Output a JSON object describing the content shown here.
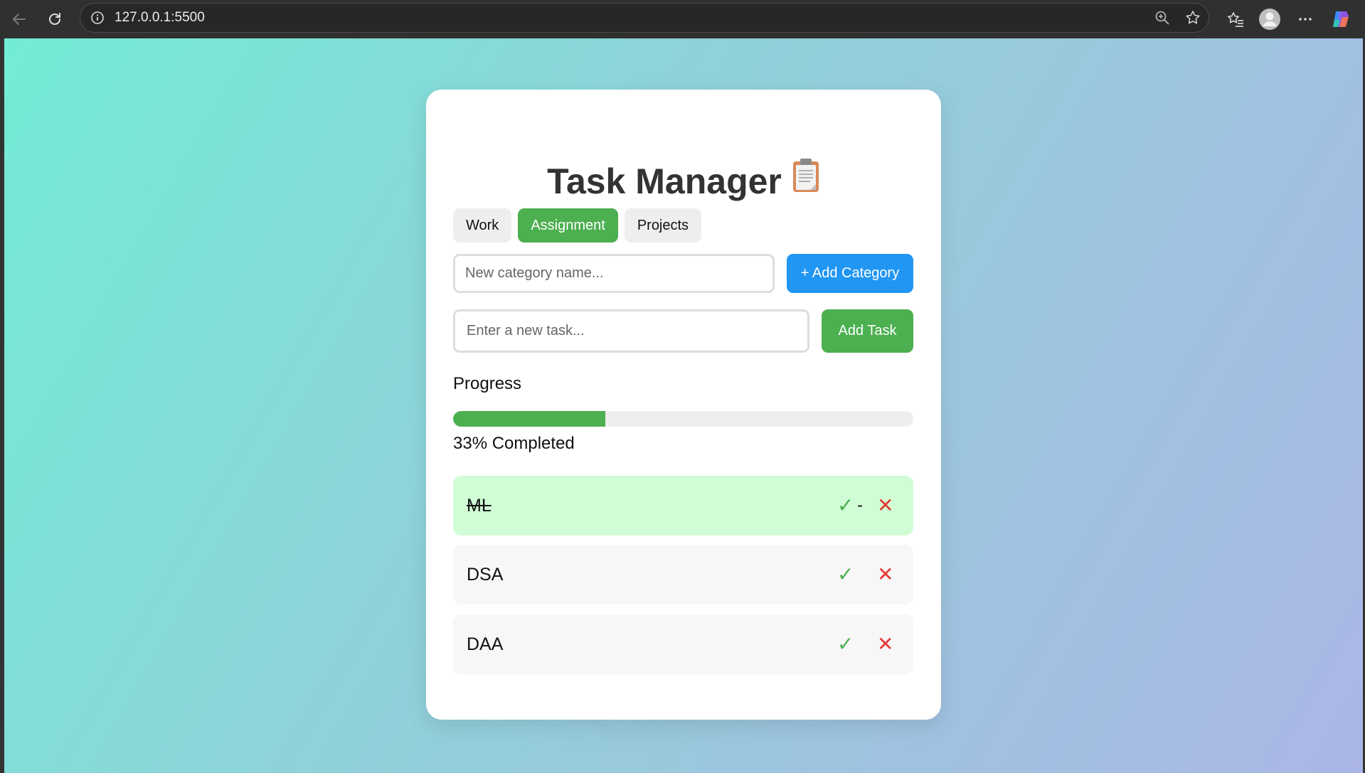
{
  "browser": {
    "url": "127.0.0.1:5500"
  },
  "app": {
    "title": "Task Manager",
    "title_icon": "clipboard-icon",
    "tabs": [
      {
        "label": "Work",
        "active": false
      },
      {
        "label": "Assignment",
        "active": true
      },
      {
        "label": "Projects",
        "active": false
      }
    ],
    "category_input": {
      "placeholder": "New category name...",
      "value": ""
    },
    "add_category_label": "+ Add Category",
    "task_input": {
      "placeholder": "Enter a new task...",
      "value": ""
    },
    "add_task_label": "Add Task",
    "progress": {
      "label": "Progress",
      "percent": 33,
      "text": "33% Completed"
    },
    "tasks": [
      {
        "text": "ML",
        "completed": true,
        "check": "✓",
        "extra": "-",
        "delete": "✕"
      },
      {
        "text": "DSA",
        "completed": false,
        "check": "✓",
        "delete": "✕"
      },
      {
        "text": "DAA",
        "completed": false,
        "check": "✓",
        "delete": "✕"
      }
    ]
  },
  "colors": {
    "accent_green": "#4caf50",
    "accent_blue": "#2196f3",
    "delete_red": "#e53935",
    "done_row_bg": "#d0fdd6"
  }
}
